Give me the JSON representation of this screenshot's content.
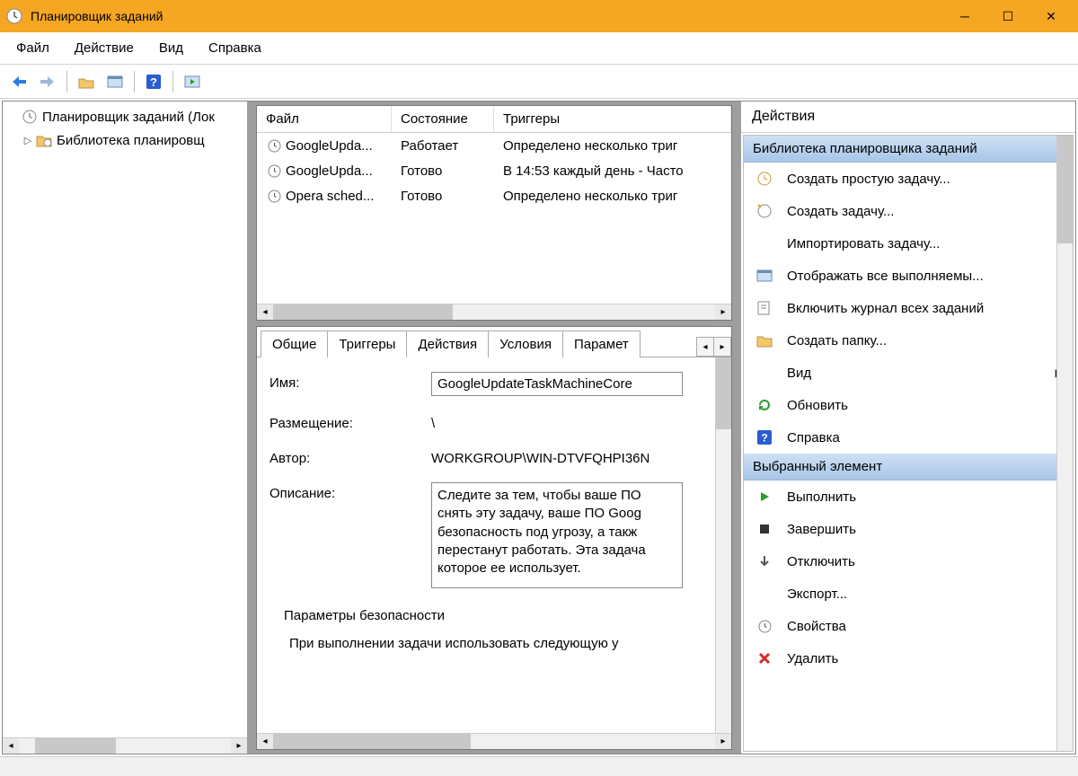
{
  "window": {
    "title": "Планировщик заданий"
  },
  "menu": {
    "file": "Файл",
    "action": "Действие",
    "view": "Вид",
    "help": "Справка"
  },
  "tree": {
    "root": "Планировщик заданий (Лок",
    "lib": "Библиотека планировщ"
  },
  "taskList": {
    "headers": {
      "file": "Файл",
      "state": "Состояние",
      "triggers": "Триггеры"
    },
    "rows": [
      {
        "file": "GoogleUpda...",
        "state": "Работает",
        "triggers": "Определено несколько триг"
      },
      {
        "file": "GoogleUpda...",
        "state": "Готово",
        "triggers": "В 14:53 каждый день - Часто"
      },
      {
        "file": "Opera sched...",
        "state": "Готово",
        "triggers": "Определено несколько триг"
      }
    ]
  },
  "tabs": {
    "general": "Общие",
    "triggers": "Триггеры",
    "actions": "Действия",
    "conditions": "Условия",
    "params": "Парамет"
  },
  "detail": {
    "nameLabel": "Имя:",
    "nameValue": "GoogleUpdateTaskMachineCore",
    "locationLabel": "Размещение:",
    "locationValue": "\\",
    "authorLabel": "Автор:",
    "authorValue": "WORKGROUP\\WIN-DTVFQHPI36N",
    "descLabel": "Описание:",
    "descValue": "Следите за тем, чтобы ваше ПО снять эту задачу, ваше ПО Goog безопасность под угрозу, а такж перестанут работать. Эта задача которое ее использует.",
    "security": "Параметры безопасности",
    "securityLine": "При выполнении задачи использовать следующую у"
  },
  "actions": {
    "title": "Действия",
    "section1": "Библиотека планировщика заданий",
    "createBasic": "Создать простую задачу...",
    "createTask": "Создать задачу...",
    "importTask": "Импортировать задачу...",
    "showRunning": "Отображать все выполняемы...",
    "enableLog": "Включить журнал всех заданий",
    "newFolder": "Создать папку...",
    "view": "Вид",
    "refresh": "Обновить",
    "help": "Справка",
    "section2": "Выбранный элемент",
    "run": "Выполнить",
    "end": "Завершить",
    "disable": "Отключить",
    "export": "Экспорт...",
    "properties": "Свойства",
    "delete": "Удалить"
  }
}
